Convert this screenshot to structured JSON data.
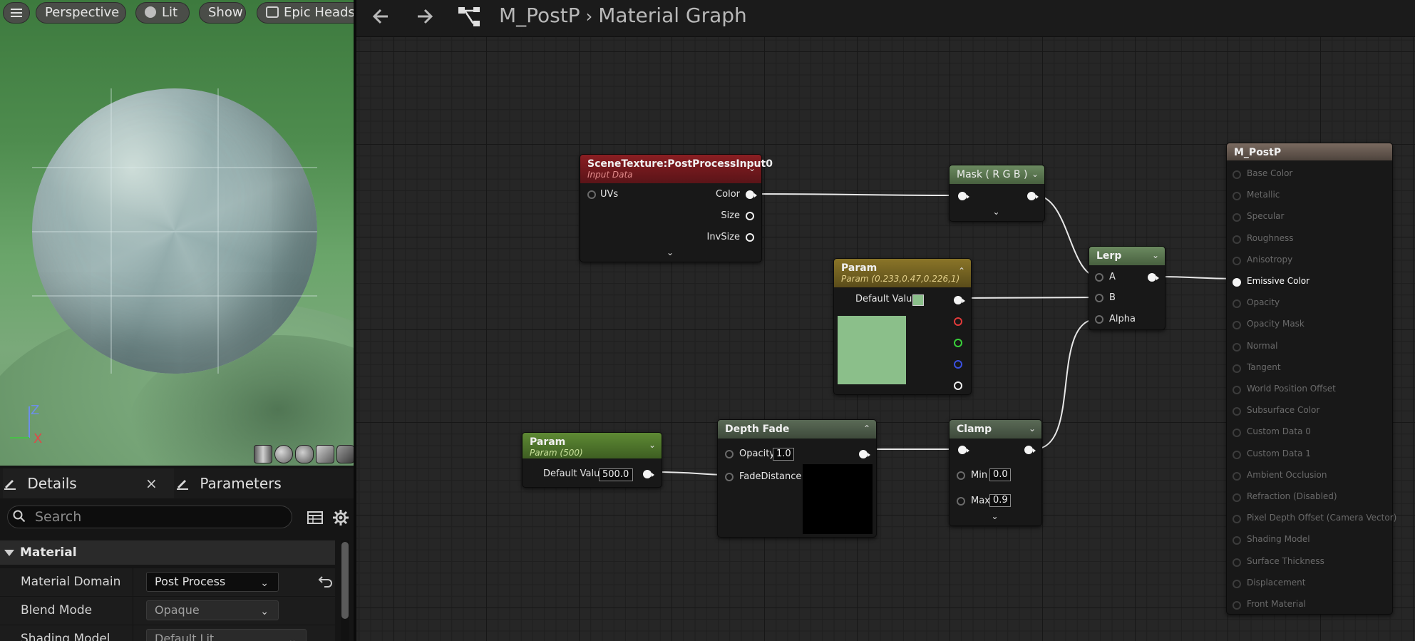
{
  "viewport": {
    "menu_icon": "hamburger-icon",
    "buttons": {
      "perspective": "Perspective",
      "lit": "Lit",
      "show": "Show",
      "headset": "Epic Headset"
    },
    "axis": {
      "z": "Z",
      "x": "X"
    }
  },
  "details": {
    "tab_details": "Details",
    "tab_parameters": "Parameters",
    "close": "×",
    "search_placeholder": "Search",
    "category": "Material",
    "props": [
      {
        "label": "Material Domain",
        "value": "Post Process"
      },
      {
        "label": "Blend Mode",
        "value": "Opaque"
      },
      {
        "label": "Shading Model",
        "value": "Default Lit"
      }
    ]
  },
  "graph": {
    "breadcrumb": {
      "asset": "M_PostP",
      "separator": "›",
      "page": "Material Graph"
    },
    "nodes": {
      "scene_texture": {
        "title": "SceneTexture:PostProcessInput0",
        "subtitle": "Input Data",
        "inputs": [
          "UVs"
        ],
        "outputs": [
          "Color",
          "Size",
          "InvSize"
        ]
      },
      "mask": {
        "title": "Mask ( R G B )"
      },
      "lerp": {
        "title": "Lerp",
        "inputs": [
          "A",
          "B",
          "Alpha"
        ]
      },
      "color_param": {
        "title": "Param",
        "subtitle": "Param (0.233,0.47,0.226,1)",
        "default_label": "Default Value",
        "swatch": "#8bbf8a"
      },
      "scalar_param": {
        "title": "Param",
        "subtitle": "Param (500)",
        "default_label": "Default Value",
        "value": "500.0"
      },
      "depth_fade": {
        "title": "Depth Fade",
        "opacity_label": "Opacity",
        "opacity_value": "1.0",
        "fade_label": "FadeDistance"
      },
      "clamp": {
        "title": "Clamp",
        "min_label": "Min",
        "min_value": "0.0",
        "max_label": "Max",
        "max_value": "0.9"
      },
      "result": {
        "title": "M_PostP",
        "inputs": [
          "Base Color",
          "Metallic",
          "Specular",
          "Roughness",
          "Anisotropy",
          "Emissive Color",
          "Opacity",
          "Opacity Mask",
          "Normal",
          "Tangent",
          "World Position Offset",
          "Subsurface Color",
          "Custom Data 0",
          "Custom Data 1",
          "Ambient Occlusion",
          "Refraction (Disabled)",
          "Pixel Depth Offset (Camera Vector)",
          "Shading Model",
          "Surface Thickness",
          "Displacement",
          "Front Material"
        ],
        "active_input": "Emissive Color"
      }
    },
    "colors": {
      "scene_texture_header": "#8a1e22",
      "mask_header": "#5d7a52",
      "lerp_header": "#5d7a52",
      "color_param_header": "#7d6a22",
      "scalar_param_header": "#4f7a2c",
      "depth_fade_header": "#4d5a4a",
      "clamp_header": "#5a6a56",
      "result_header": "#6e5f55"
    }
  }
}
